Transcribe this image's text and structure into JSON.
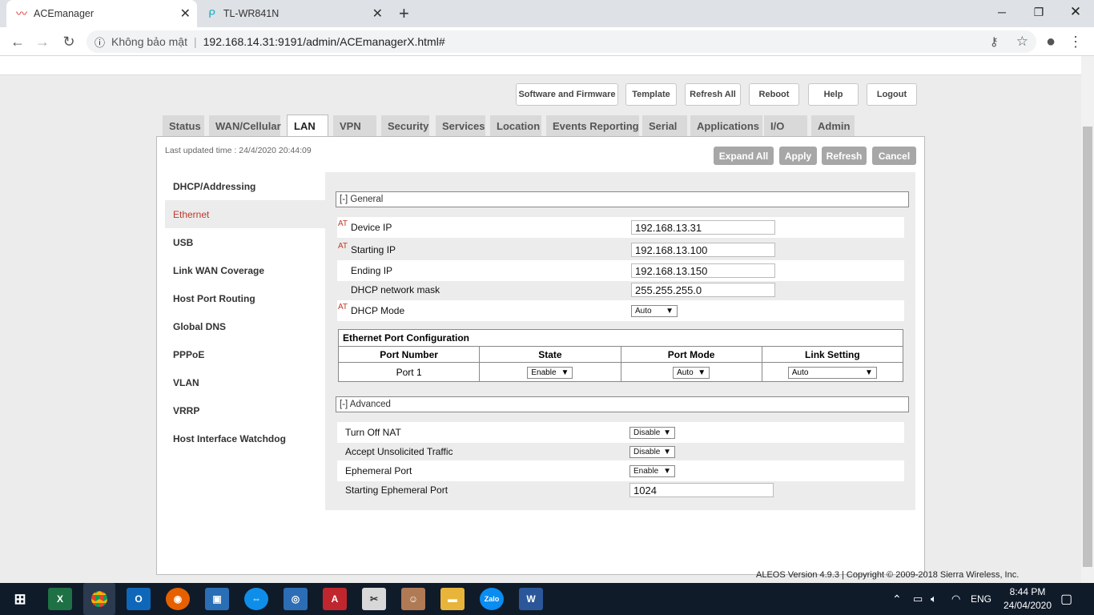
{
  "browser": {
    "tabs": [
      {
        "title": "ACEmanager"
      },
      {
        "title": "TL-WR841N"
      }
    ],
    "url_security": "Không bảo mật",
    "url": "192.168.14.31:9191/admin/ACEmanagerX.html#"
  },
  "top_buttons": [
    "Software and Firmware",
    "Template",
    "Refresh All",
    "Reboot",
    "Help",
    "Logout"
  ],
  "main_tabs": [
    "Status",
    "WAN/Cellular",
    "LAN",
    "VPN",
    "Security",
    "Services",
    "Location",
    "Events Reporting",
    "Serial",
    "Applications",
    "I/O",
    "Admin"
  ],
  "last_updated": "Last updated time : 24/4/2020 20:44:09",
  "actions": [
    "Expand All",
    "Apply",
    "Refresh",
    "Cancel"
  ],
  "sidebar": [
    "DHCP/Addressing",
    "Ethernet",
    "USB",
    "Link WAN Coverage",
    "Host Port Routing",
    "Global DNS",
    "PPPoE",
    "VLAN",
    "VRRP",
    "Host Interface Watchdog"
  ],
  "general": {
    "header": "[-] General",
    "at": "AT",
    "fields": [
      {
        "label": "Device IP",
        "value": "192.168.13.31"
      },
      {
        "label": "Starting IP",
        "value": "192.168.13.100"
      },
      {
        "label": "Ending IP",
        "value": "192.168.13.150"
      },
      {
        "label": "DHCP network mask",
        "value": "255.255.255.0"
      },
      {
        "label": "DHCP Mode",
        "value": "Auto"
      }
    ]
  },
  "port_config": {
    "title": "Ethernet Port Configuration",
    "headers": [
      "Port Number",
      "State",
      "Port Mode",
      "Link Setting"
    ],
    "row": {
      "port": "Port 1",
      "state": "Enable",
      "mode": "Auto",
      "link": "Auto"
    }
  },
  "advanced": {
    "header": "[-] Advanced",
    "fields": [
      {
        "label": "Turn Off NAT",
        "value": "Disable"
      },
      {
        "label": "Accept Unsolicited Traffic",
        "value": "Disable"
      },
      {
        "label": "Ephemeral Port",
        "value": "Enable"
      },
      {
        "label": "Starting Ephemeral Port",
        "value": "1024"
      }
    ]
  },
  "footer": "ALEOS Version 4.9.3 | Copyright © 2009-2018 Sierra Wireless, Inc.",
  "taskbar": {
    "lang": "ENG",
    "time": "8:44 PM",
    "date": "24/04/2020"
  },
  "colors": {
    "accent_red": "#c0392b",
    "taskbar": "#101b2a"
  }
}
